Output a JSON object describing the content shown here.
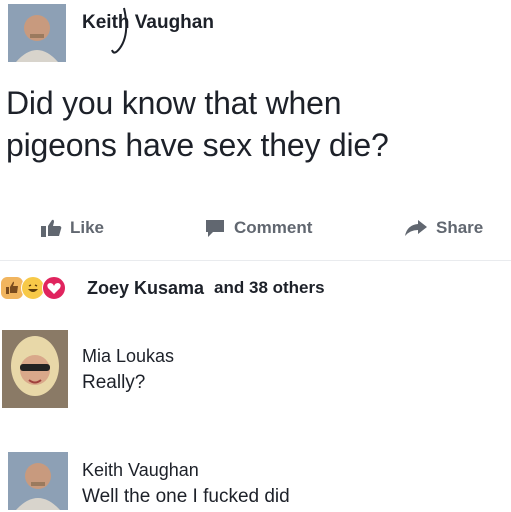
{
  "post": {
    "author": "Keith Vaughan",
    "text_line1": "Did you know that when",
    "text_line2": "pigeons have sex they die?"
  },
  "actions": {
    "like": "Like",
    "comment": "Comment",
    "share": "Share"
  },
  "reactions": {
    "icons": [
      "thumbs-up-icon",
      "laughing-face-icon",
      "heart-icon"
    ],
    "summary_name": "Zoey Kusama",
    "summary_rest": "and 38 others"
  },
  "comments": [
    {
      "author": "Mia Loukas",
      "text": "Really?"
    },
    {
      "author": "Keith Vaughan",
      "text": "Well the one I fucked did"
    }
  ],
  "colors": {
    "text": "#1d2129",
    "muted": "#616770",
    "like_blue": "#4267b2",
    "heart_red": "#e0245e",
    "haha_yellow": "#f7c948"
  }
}
